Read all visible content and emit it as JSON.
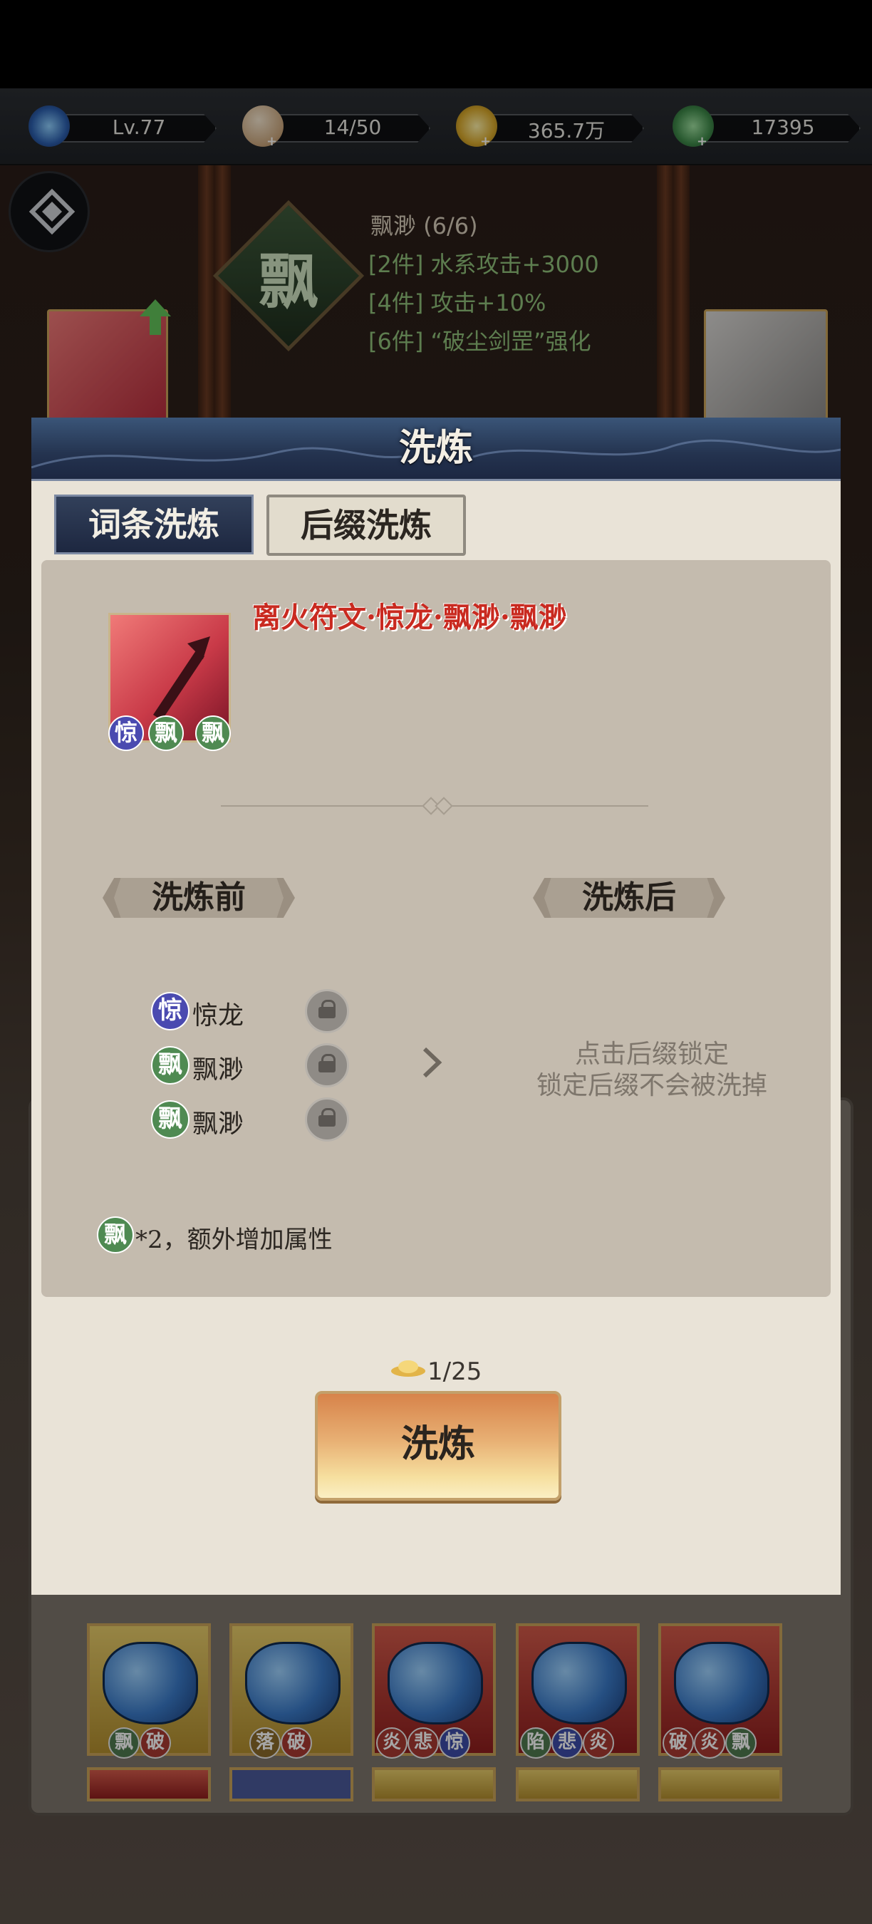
{
  "status_bar": {
    "level": "Lv.77",
    "stamina": "14/50",
    "coins": "365.7万",
    "gems": "17395"
  },
  "equip_set": {
    "emblem_char": "飘",
    "name": "飘渺 (6/6)",
    "bonuses": [
      "[2件] 水系攻击+3000",
      "[4件] 攻击+10%",
      "[6件] “破尘剑罡”强化"
    ]
  },
  "dialog": {
    "title": "洗炼",
    "tabs": [
      {
        "label": "词条洗炼",
        "active": true
      },
      {
        "label": "后缀洗炼",
        "active": false
      }
    ],
    "item": {
      "name": "离火符文·惊龙·飘渺·飘渺",
      "badges": [
        "惊",
        "飘",
        "飘"
      ]
    },
    "before_label": "洗炼前",
    "after_label": "洗炼后",
    "affixes": [
      {
        "badge": "惊",
        "name": "惊龙",
        "color": "#4a4ab0"
      },
      {
        "badge": "飘",
        "name": "飘渺",
        "color": "#4f8a52"
      },
      {
        "badge": "飘",
        "name": "飘渺",
        "color": "#4f8a52"
      }
    ],
    "hint_line1": "点击后缀锁定",
    "hint_line2": "锁定后缀不会被洗掉",
    "bonus_badge": "飘",
    "bonus_text": "*2，额外增加属性",
    "cost": "1/25",
    "refine_button": "洗炼"
  },
  "bg_grid": [
    {
      "badges": [
        "飘",
        "破"
      ]
    },
    {
      "badges": [
        "落",
        "破"
      ]
    },
    {
      "badges": [
        "炎",
        "悲",
        "惊"
      ]
    },
    {
      "badges": [
        "陷",
        "悲",
        "炎"
      ]
    },
    {
      "badges": [
        "破",
        "炎",
        "飘"
      ]
    }
  ]
}
